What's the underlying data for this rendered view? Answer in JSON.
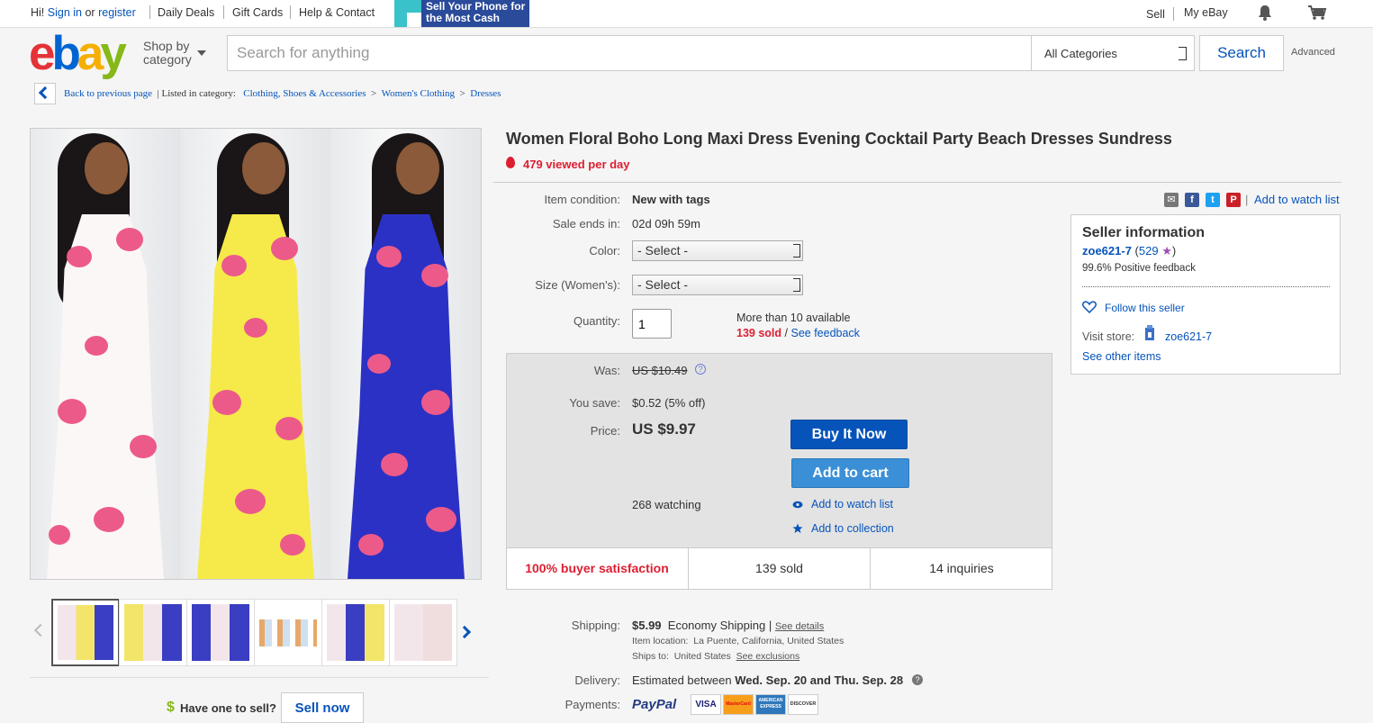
{
  "topbar": {
    "hi": "Hi!",
    "sign_in": "Sign in",
    "or": "or",
    "register": "register",
    "daily_deals": "Daily Deals",
    "gift_cards": "Gift Cards",
    "help_contact": "Help & Contact",
    "promo": "Sell Your Phone for the Most Cash",
    "sell": "Sell",
    "my_ebay": "My eBay"
  },
  "header": {
    "logo": {
      "e": "e",
      "b": "b",
      "a": "a",
      "y": "y"
    },
    "shop_by": "Shop by",
    "category": "category",
    "search_placeholder": "Search for anything",
    "category_select": "All Categories",
    "search_button": "Search",
    "advanced": "Advanced"
  },
  "breadcrumb": {
    "back": "Back to previous page",
    "listed_in": "| Listed in category:",
    "items": [
      "Clothing, Shoes & Accessories",
      "Women's Clothing",
      "Dresses"
    ],
    "separator": ">"
  },
  "item": {
    "title": "Women Floral Boho Long Maxi Dress Evening Cocktail Party Beach Dresses Sundress",
    "viewed": "479 viewed per day",
    "condition_label": "Item condition:",
    "condition": "New with tags",
    "sale_ends_label": "Sale ends in:",
    "sale_ends": "02d 09h 59m",
    "color_label": "Color:",
    "color_value": "- Select -",
    "size_label": "Size (Women's):",
    "size_value": "- Select -",
    "quantity_label": "Quantity:",
    "quantity_value": "1",
    "available": "More than 10 available",
    "sold": "139 sold",
    "slash": "/",
    "see_feedback": "See feedback",
    "add_to_watch_list": "Add to watch list",
    "share_sep": "|"
  },
  "pricebox": {
    "was_label": "Was:",
    "was": "US $10.49",
    "save_label": "You save:",
    "save": "$0.52 (5% off)",
    "price_label": "Price:",
    "price": "US $9.97",
    "buy_now": "Buy It Now",
    "add_to_cart": "Add to cart",
    "watching": "268 watching",
    "add_watch": "Add to watch list",
    "add_collection": "Add to collection",
    "satisfaction": "100% buyer satisfaction",
    "sold": "139 sold",
    "inquiries": "14 inquiries"
  },
  "seller": {
    "heading": "Seller information",
    "name": "zoe621-7",
    "score_open": "(",
    "score": "529",
    "score_close": ")",
    "feedback": "99.6% Positive feedback",
    "follow": "Follow this seller",
    "visit_store_label": "Visit store:",
    "store_name": "zoe621-7",
    "other_items": "See other items"
  },
  "shipping": {
    "label": "Shipping:",
    "cost": "$5.99",
    "method": "Economy Shipping",
    "sep": "|",
    "details": "See details",
    "location_label": "Item location:",
    "location": "La Puente, California, United States",
    "ships_to_label": "Ships to:",
    "ships_to": "United States",
    "exclusions": "See exclusions",
    "delivery_label": "Delivery:",
    "delivery_prefix": "Estimated between",
    "delivery_dates": "Wed. Sep. 20 and Thu. Sep. 28",
    "payments_label": "Payments:",
    "paypal": "PayPal",
    "cards": [
      "VISA",
      "MasterCard",
      "AMERICAN EXPRESS",
      "DISCOVER"
    ]
  },
  "sell_prompt": {
    "have_one": "Have one to sell?",
    "sell_now": "Sell now",
    "dollar": "$"
  },
  "colors": {
    "accent_blue": "#0654ba",
    "red": "#dd1e31",
    "buy_now": "#0654ba",
    "add_cart": "#3a8fd6"
  }
}
